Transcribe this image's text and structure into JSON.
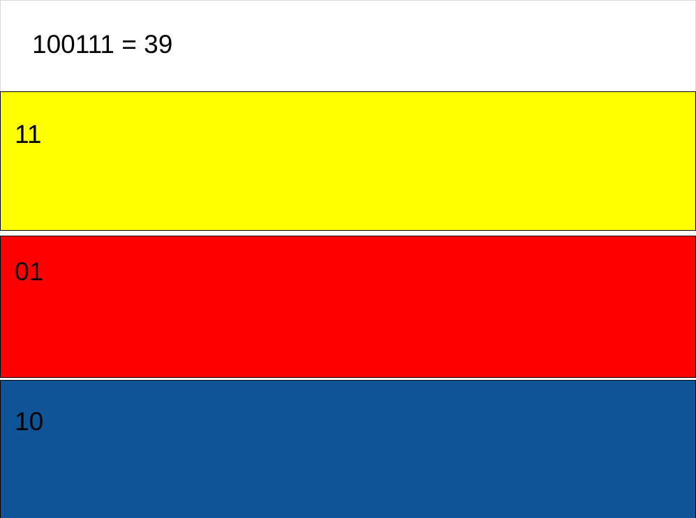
{
  "header": {
    "text": "100111 = 39"
  },
  "bands": [
    {
      "label": "11",
      "color": "#FFFF00"
    },
    {
      "label": "01",
      "color": "#FF0000"
    },
    {
      "label": "10",
      "color": "#0F5496"
    }
  ]
}
